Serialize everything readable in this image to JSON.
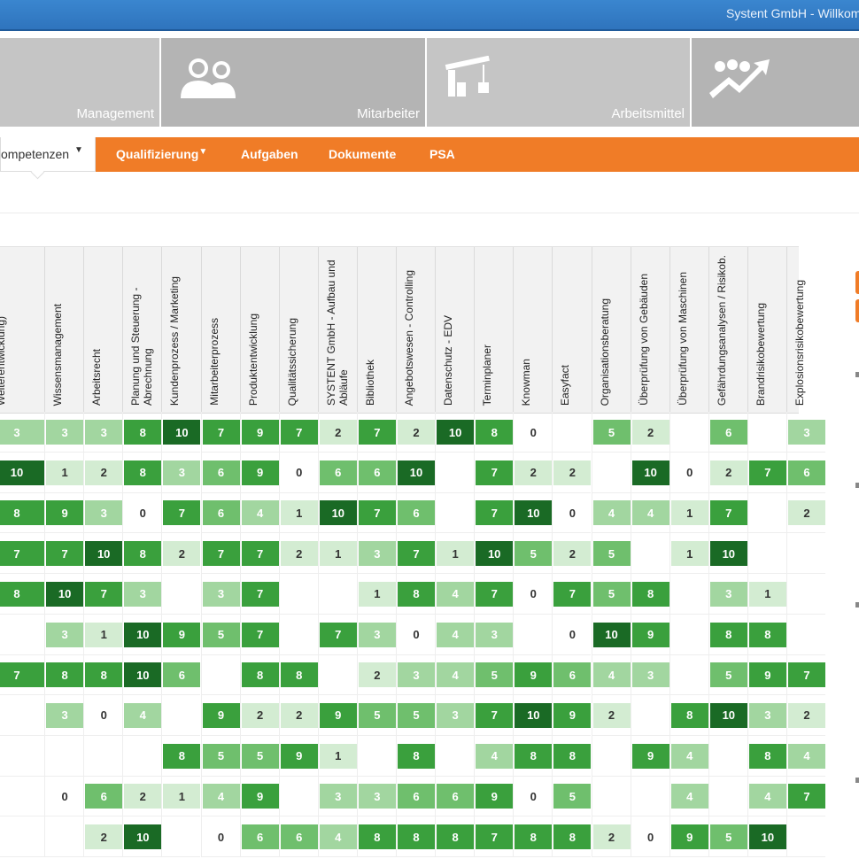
{
  "header": {
    "company": "Systent GmbH  -  Willkom"
  },
  "modules": [
    {
      "label": "Management",
      "icon": "management-icon"
    },
    {
      "label": "Mitarbeiter",
      "icon": "people-icon"
    },
    {
      "label": "Arbeitsmittel",
      "icon": "crane-icon"
    },
    {
      "label": "",
      "icon": "growth-chart-icon"
    }
  ],
  "nav": {
    "active": "ompetenzen",
    "items": [
      "Qualifizierung",
      "Aufgaben",
      "Dokumente",
      "PSA"
    ]
  },
  "columns": [
    "Weiterentwicklung)",
    "Wissensmanagement",
    "Arbeitsrecht",
    "Planung und Steuerung - Abrechnung",
    "Kundenprozess / Marketing",
    "Mitarbeiterprozess",
    "Produktentwicklung",
    "Qualitätssicherung",
    "SYSTENT GmbH - Aufbau und Abläufe",
    "Bibliothek",
    "Angebotswesen - Controlling",
    "Datenschutz - EDV",
    "Terminplaner",
    "Knowman",
    "Easyfact",
    "Organisationsberatung",
    "Überprüfung von Gebäuden",
    "Überprüfung von Maschinen",
    "Gefährdungsanalysen / Risikob.",
    "Brandrisikobewertung",
    "Explosionsrisikobewertung"
  ],
  "rows": [
    [
      3,
      3,
      3,
      8,
      10,
      7,
      9,
      7,
      2,
      7,
      2,
      10,
      8,
      0,
      null,
      5,
      2,
      null,
      6,
      null,
      3
    ],
    [
      10,
      1,
      2,
      8,
      3,
      6,
      9,
      0,
      6,
      6,
      10,
      null,
      7,
      2,
      2,
      null,
      10,
      0,
      2,
      7,
      6
    ],
    [
      8,
      9,
      3,
      0,
      7,
      6,
      4,
      1,
      10,
      7,
      6,
      null,
      7,
      10,
      0,
      4,
      4,
      1,
      7,
      null,
      2
    ],
    [
      7,
      7,
      10,
      8,
      2,
      7,
      7,
      2,
      1,
      3,
      7,
      1,
      10,
      5,
      2,
      5,
      null,
      1,
      10,
      null,
      null
    ],
    [
      8,
      10,
      7,
      3,
      null,
      3,
      7,
      null,
      null,
      1,
      8,
      4,
      7,
      0,
      7,
      5,
      8,
      null,
      3,
      1,
      null
    ],
    [
      null,
      3,
      1,
      10,
      9,
      5,
      7,
      null,
      7,
      3,
      0,
      4,
      3,
      null,
      0,
      10,
      9,
      null,
      8,
      8,
      null
    ],
    [
      7,
      8,
      8,
      10,
      6,
      null,
      8,
      8,
      null,
      2,
      3,
      4,
      5,
      9,
      6,
      4,
      3,
      null,
      5,
      9,
      7
    ],
    [
      null,
      3,
      0,
      4,
      null,
      9,
      2,
      2,
      9,
      5,
      5,
      3,
      7,
      10,
      9,
      2,
      null,
      8,
      10,
      3,
      2
    ],
    [
      null,
      null,
      null,
      null,
      8,
      5,
      5,
      9,
      1,
      null,
      8,
      null,
      4,
      8,
      8,
      null,
      9,
      4,
      null,
      8,
      4
    ],
    [
      null,
      0,
      6,
      2,
      1,
      4,
      9,
      null,
      3,
      3,
      6,
      6,
      9,
      0,
      5,
      null,
      null,
      4,
      null,
      4,
      7
    ],
    [
      null,
      null,
      2,
      10,
      null,
      0,
      6,
      6,
      4,
      8,
      8,
      8,
      7,
      8,
      8,
      2,
      0,
      9,
      5,
      10,
      null
    ]
  ],
  "colors": {
    "topbar": "#2f74bd",
    "nav": "#f07c27",
    "level_1_2": "#d3ecd2",
    "level_3_4": "#a2d6a0",
    "level_5_6": "#6fbf6d",
    "level_7_9": "#3aa03d",
    "level_10": "#1a6a25"
  }
}
